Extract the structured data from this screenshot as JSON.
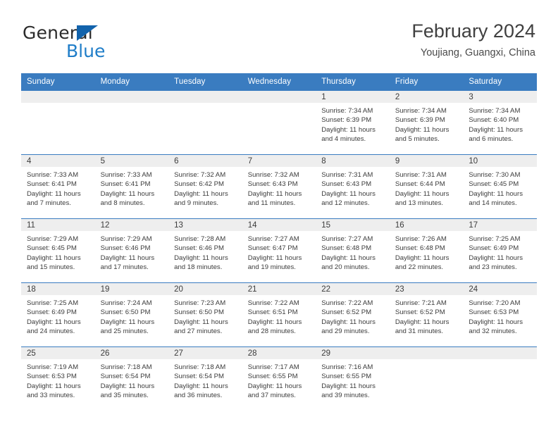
{
  "brand": {
    "name_part1": "General",
    "name_part2": "Blue",
    "accent_color": "#1f7dc8",
    "triangle_color": "#1263ac"
  },
  "header": {
    "title": "February 2024",
    "subtitle": "Youjiang, Guangxi, China"
  },
  "theme": {
    "header_row_color": "#3a7cc0",
    "daynum_band_color": "#eeeeee",
    "text_color": "#3c3c3c"
  },
  "weekday_headers": [
    "Sunday",
    "Monday",
    "Tuesday",
    "Wednesday",
    "Thursday",
    "Friday",
    "Saturday"
  ],
  "weeks": [
    [
      {
        "day": "",
        "sunrise": "",
        "sunset": "",
        "daylight_line1": "",
        "daylight_line2": ""
      },
      {
        "day": "",
        "sunrise": "",
        "sunset": "",
        "daylight_line1": "",
        "daylight_line2": ""
      },
      {
        "day": "",
        "sunrise": "",
        "sunset": "",
        "daylight_line1": "",
        "daylight_line2": ""
      },
      {
        "day": "",
        "sunrise": "",
        "sunset": "",
        "daylight_line1": "",
        "daylight_line2": ""
      },
      {
        "day": "1",
        "sunrise": "Sunrise: 7:34 AM",
        "sunset": "Sunset: 6:39 PM",
        "daylight_line1": "Daylight: 11 hours",
        "daylight_line2": "and 4 minutes."
      },
      {
        "day": "2",
        "sunrise": "Sunrise: 7:34 AM",
        "sunset": "Sunset: 6:39 PM",
        "daylight_line1": "Daylight: 11 hours",
        "daylight_line2": "and 5 minutes."
      },
      {
        "day": "3",
        "sunrise": "Sunrise: 7:34 AM",
        "sunset": "Sunset: 6:40 PM",
        "daylight_line1": "Daylight: 11 hours",
        "daylight_line2": "and 6 minutes."
      }
    ],
    [
      {
        "day": "4",
        "sunrise": "Sunrise: 7:33 AM",
        "sunset": "Sunset: 6:41 PM",
        "daylight_line1": "Daylight: 11 hours",
        "daylight_line2": "and 7 minutes."
      },
      {
        "day": "5",
        "sunrise": "Sunrise: 7:33 AM",
        "sunset": "Sunset: 6:41 PM",
        "daylight_line1": "Daylight: 11 hours",
        "daylight_line2": "and 8 minutes."
      },
      {
        "day": "6",
        "sunrise": "Sunrise: 7:32 AM",
        "sunset": "Sunset: 6:42 PM",
        "daylight_line1": "Daylight: 11 hours",
        "daylight_line2": "and 9 minutes."
      },
      {
        "day": "7",
        "sunrise": "Sunrise: 7:32 AM",
        "sunset": "Sunset: 6:43 PM",
        "daylight_line1": "Daylight: 11 hours",
        "daylight_line2": "and 11 minutes."
      },
      {
        "day": "8",
        "sunrise": "Sunrise: 7:31 AM",
        "sunset": "Sunset: 6:43 PM",
        "daylight_line1": "Daylight: 11 hours",
        "daylight_line2": "and 12 minutes."
      },
      {
        "day": "9",
        "sunrise": "Sunrise: 7:31 AM",
        "sunset": "Sunset: 6:44 PM",
        "daylight_line1": "Daylight: 11 hours",
        "daylight_line2": "and 13 minutes."
      },
      {
        "day": "10",
        "sunrise": "Sunrise: 7:30 AM",
        "sunset": "Sunset: 6:45 PM",
        "daylight_line1": "Daylight: 11 hours",
        "daylight_line2": "and 14 minutes."
      }
    ],
    [
      {
        "day": "11",
        "sunrise": "Sunrise: 7:29 AM",
        "sunset": "Sunset: 6:45 PM",
        "daylight_line1": "Daylight: 11 hours",
        "daylight_line2": "and 15 minutes."
      },
      {
        "day": "12",
        "sunrise": "Sunrise: 7:29 AM",
        "sunset": "Sunset: 6:46 PM",
        "daylight_line1": "Daylight: 11 hours",
        "daylight_line2": "and 17 minutes."
      },
      {
        "day": "13",
        "sunrise": "Sunrise: 7:28 AM",
        "sunset": "Sunset: 6:46 PM",
        "daylight_line1": "Daylight: 11 hours",
        "daylight_line2": "and 18 minutes."
      },
      {
        "day": "14",
        "sunrise": "Sunrise: 7:27 AM",
        "sunset": "Sunset: 6:47 PM",
        "daylight_line1": "Daylight: 11 hours",
        "daylight_line2": "and 19 minutes."
      },
      {
        "day": "15",
        "sunrise": "Sunrise: 7:27 AM",
        "sunset": "Sunset: 6:48 PM",
        "daylight_line1": "Daylight: 11 hours",
        "daylight_line2": "and 20 minutes."
      },
      {
        "day": "16",
        "sunrise": "Sunrise: 7:26 AM",
        "sunset": "Sunset: 6:48 PM",
        "daylight_line1": "Daylight: 11 hours",
        "daylight_line2": "and 22 minutes."
      },
      {
        "day": "17",
        "sunrise": "Sunrise: 7:25 AM",
        "sunset": "Sunset: 6:49 PM",
        "daylight_line1": "Daylight: 11 hours",
        "daylight_line2": "and 23 minutes."
      }
    ],
    [
      {
        "day": "18",
        "sunrise": "Sunrise: 7:25 AM",
        "sunset": "Sunset: 6:49 PM",
        "daylight_line1": "Daylight: 11 hours",
        "daylight_line2": "and 24 minutes."
      },
      {
        "day": "19",
        "sunrise": "Sunrise: 7:24 AM",
        "sunset": "Sunset: 6:50 PM",
        "daylight_line1": "Daylight: 11 hours",
        "daylight_line2": "and 25 minutes."
      },
      {
        "day": "20",
        "sunrise": "Sunrise: 7:23 AM",
        "sunset": "Sunset: 6:50 PM",
        "daylight_line1": "Daylight: 11 hours",
        "daylight_line2": "and 27 minutes."
      },
      {
        "day": "21",
        "sunrise": "Sunrise: 7:22 AM",
        "sunset": "Sunset: 6:51 PM",
        "daylight_line1": "Daylight: 11 hours",
        "daylight_line2": "and 28 minutes."
      },
      {
        "day": "22",
        "sunrise": "Sunrise: 7:22 AM",
        "sunset": "Sunset: 6:52 PM",
        "daylight_line1": "Daylight: 11 hours",
        "daylight_line2": "and 29 minutes."
      },
      {
        "day": "23",
        "sunrise": "Sunrise: 7:21 AM",
        "sunset": "Sunset: 6:52 PM",
        "daylight_line1": "Daylight: 11 hours",
        "daylight_line2": "and 31 minutes."
      },
      {
        "day": "24",
        "sunrise": "Sunrise: 7:20 AM",
        "sunset": "Sunset: 6:53 PM",
        "daylight_line1": "Daylight: 11 hours",
        "daylight_line2": "and 32 minutes."
      }
    ],
    [
      {
        "day": "25",
        "sunrise": "Sunrise: 7:19 AM",
        "sunset": "Sunset: 6:53 PM",
        "daylight_line1": "Daylight: 11 hours",
        "daylight_line2": "and 33 minutes."
      },
      {
        "day": "26",
        "sunrise": "Sunrise: 7:18 AM",
        "sunset": "Sunset: 6:54 PM",
        "daylight_line1": "Daylight: 11 hours",
        "daylight_line2": "and 35 minutes."
      },
      {
        "day": "27",
        "sunrise": "Sunrise: 7:18 AM",
        "sunset": "Sunset: 6:54 PM",
        "daylight_line1": "Daylight: 11 hours",
        "daylight_line2": "and 36 minutes."
      },
      {
        "day": "28",
        "sunrise": "Sunrise: 7:17 AM",
        "sunset": "Sunset: 6:55 PM",
        "daylight_line1": "Daylight: 11 hours",
        "daylight_line2": "and 37 minutes."
      },
      {
        "day": "29",
        "sunrise": "Sunrise: 7:16 AM",
        "sunset": "Sunset: 6:55 PM",
        "daylight_line1": "Daylight: 11 hours",
        "daylight_line2": "and 39 minutes."
      },
      {
        "day": "",
        "sunrise": "",
        "sunset": "",
        "daylight_line1": "",
        "daylight_line2": ""
      },
      {
        "day": "",
        "sunrise": "",
        "sunset": "",
        "daylight_line1": "",
        "daylight_line2": ""
      }
    ]
  ]
}
